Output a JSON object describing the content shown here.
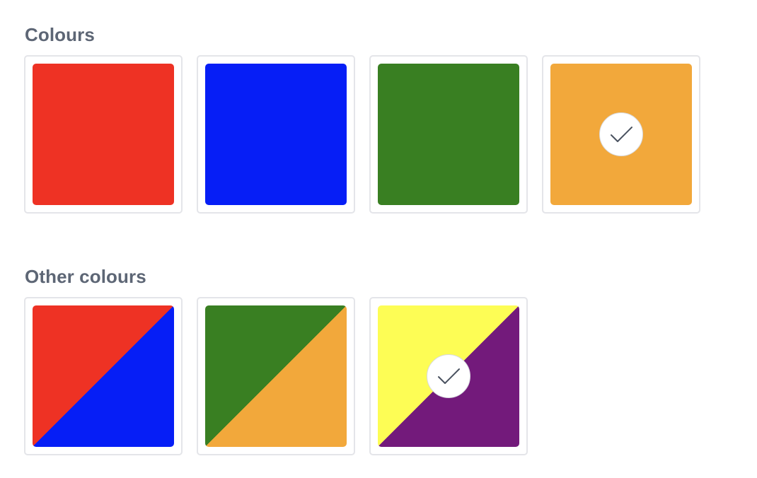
{
  "sections": [
    {
      "title": "Colours",
      "swatches": [
        {
          "name": "red",
          "colors": [
            "#ee3224"
          ],
          "selected": false
        },
        {
          "name": "blue",
          "colors": [
            "#061ef6"
          ],
          "selected": false
        },
        {
          "name": "green",
          "colors": [
            "#397f22"
          ],
          "selected": false
        },
        {
          "name": "orange",
          "colors": [
            "#f2a83b"
          ],
          "selected": true
        }
      ]
    },
    {
      "title": "Other colours",
      "swatches": [
        {
          "name": "red-blue",
          "colors": [
            "#ee3224",
            "#061ef6"
          ],
          "selected": false
        },
        {
          "name": "green-orange",
          "colors": [
            "#397f22",
            "#f2a83b"
          ],
          "selected": false
        },
        {
          "name": "yellow-purple",
          "colors": [
            "#fdfd55",
            "#731a7b"
          ],
          "selected": true
        }
      ]
    }
  ],
  "icons": {
    "selected": "checkmark-icon"
  }
}
